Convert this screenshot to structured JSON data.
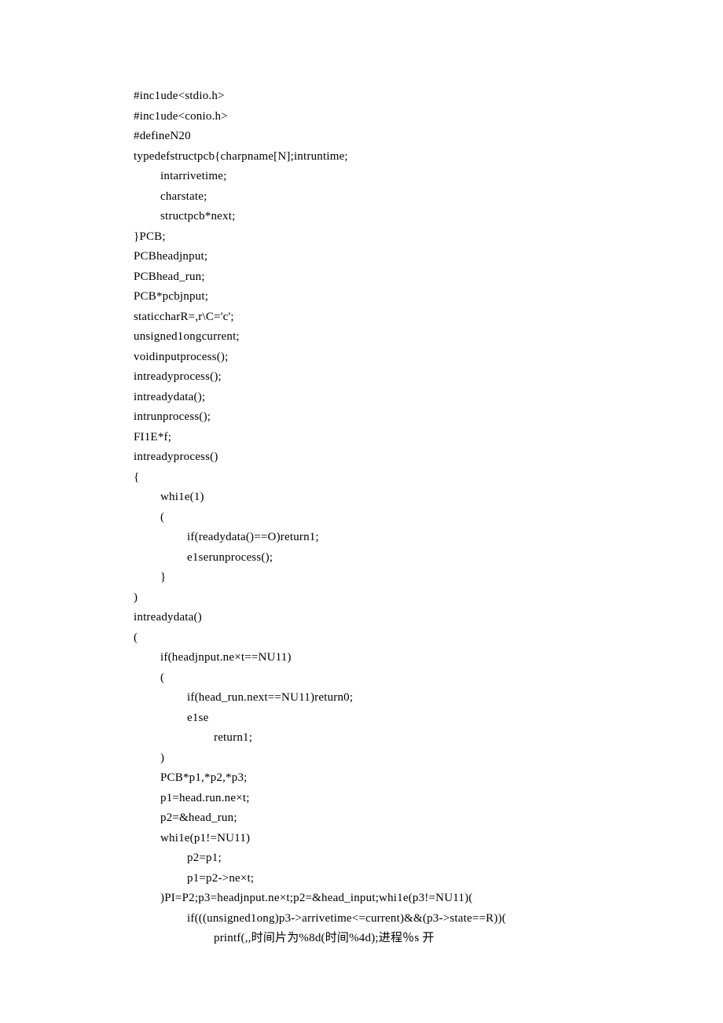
{
  "code": {
    "lines": [
      {
        "indent": 0,
        "text": "#inc1ude<stdio.h>"
      },
      {
        "indent": 0,
        "text": "#inc1ude<conio.h>"
      },
      {
        "indent": 0,
        "text": "#defineN20"
      },
      {
        "indent": 0,
        "text": "typedefstructpcb{charpname[N];intruntime;"
      },
      {
        "indent": 1,
        "text": "intarrivetime;"
      },
      {
        "indent": 1,
        "text": "charstate;"
      },
      {
        "indent": 1,
        "text": "structpcb*next;"
      },
      {
        "indent": 0,
        "text": "}PCB;"
      },
      {
        "indent": 0,
        "text": "PCBheadjnput;"
      },
      {
        "indent": 0,
        "text": "PCBhead_run;"
      },
      {
        "indent": 0,
        "text": "PCB*pcbjnput;"
      },
      {
        "indent": 0,
        "text": "staticcharR=,r\\C='c';"
      },
      {
        "indent": 0,
        "text": "unsigned1ongcurrent;"
      },
      {
        "indent": 0,
        "text": "voidinputprocess();"
      },
      {
        "indent": 0,
        "text": "intreadyprocess();"
      },
      {
        "indent": 0,
        "text": "intreadydata();"
      },
      {
        "indent": 0,
        "text": "intrunprocess();"
      },
      {
        "indent": 0,
        "text": "FI1E*f;"
      },
      {
        "indent": 0,
        "text": "intreadyprocess()"
      },
      {
        "indent": 0,
        "text": "{"
      },
      {
        "indent": 1,
        "text": "whi1e(1)"
      },
      {
        "indent": 1,
        "text": "("
      },
      {
        "indent": 2,
        "text": "if(readydata()==O)return1;"
      },
      {
        "indent": 2,
        "text": "e1serunprocess();"
      },
      {
        "indent": 1,
        "text": "}"
      },
      {
        "indent": 0,
        "text": ")"
      },
      {
        "indent": 0,
        "text": "intreadydata()"
      },
      {
        "indent": 0,
        "text": "("
      },
      {
        "indent": 1,
        "text": "if(headjnput.ne×t==NU11)"
      },
      {
        "indent": 1,
        "text": "("
      },
      {
        "indent": 2,
        "text": "if(head_run.next==NU11)return0;"
      },
      {
        "indent": 2,
        "text": "e1se"
      },
      {
        "indent": 3,
        "text": "return1;"
      },
      {
        "indent": 1,
        "text": ")"
      },
      {
        "indent": 1,
        "text": "PCB*p1,*p2,*p3;"
      },
      {
        "indent": 1,
        "text": "p1=head.run.ne×t;"
      },
      {
        "indent": 1,
        "text": "p2=&head_run;"
      },
      {
        "indent": 1,
        "text": "whi1e(p1!=NU11)"
      },
      {
        "indent": 2,
        "text": "p2=p1;"
      },
      {
        "indent": 2,
        "text": "p1=p2->ne×t;"
      },
      {
        "indent": 1,
        "text": ")PI=P2;p3=headjnput.ne×t;p2=&head_input;whi1e(p3!=NU11)("
      },
      {
        "indent": 2,
        "text": "if(((unsigned1ong)p3->arrivetime<=current)&&(p3->state==R))("
      },
      {
        "indent": 3,
        "text": "printf(,,时间片为%8d(时间%4d);进程％s 开"
      }
    ]
  }
}
